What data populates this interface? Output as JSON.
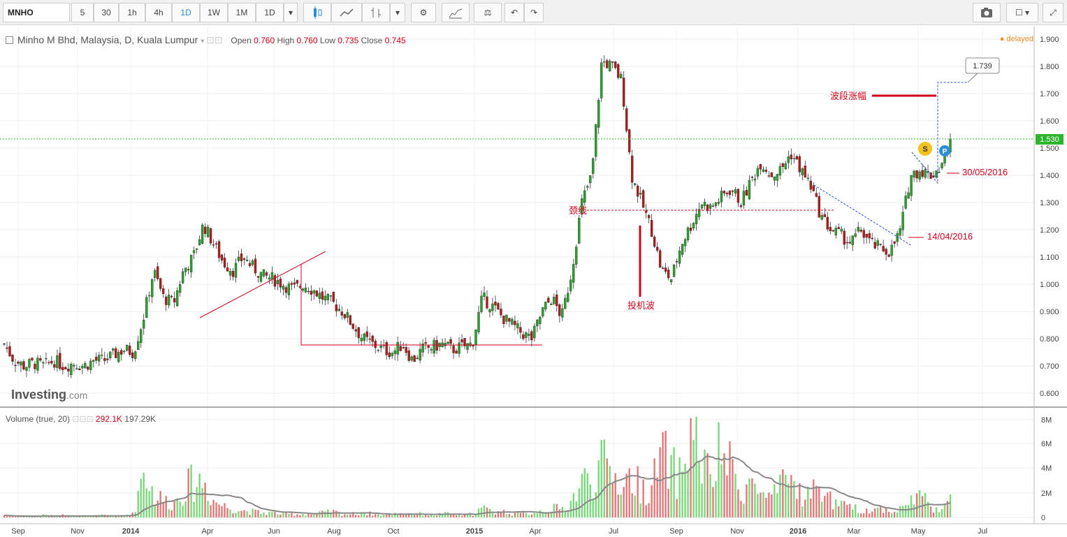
{
  "toolbar": {
    "symbol": "MNHO",
    "intervals": [
      "5",
      "30",
      "1h",
      "4h",
      "1D",
      "1W",
      "1M",
      "1D"
    ],
    "active_interval": "1D"
  },
  "legend": {
    "title": "Minho M Bhd, Malaysia, D, Kuala Lumpur",
    "open_label": "Open",
    "open": "0.760",
    "high_label": "High",
    "high": "0.760",
    "low_label": "Low",
    "low": "0.735",
    "close_label": "Close",
    "close": "0.745"
  },
  "status": {
    "delayed": "delayed"
  },
  "volume_legend": {
    "label": "Volume (true, 20)",
    "value1": "292.1K",
    "value2": "197.29K"
  },
  "logo": {
    "brand": "Investing",
    "suffix": ".com"
  },
  "annotations": {
    "neckline": "颈线",
    "speculative_wave": "投机波",
    "wave_rise": "波段涨幅",
    "target": "1.739",
    "date1": "30/05/2016",
    "date2": "14/04/2016",
    "marker_s": "S",
    "marker_p": "P"
  },
  "chart_data": {
    "type": "candlestick",
    "price_axis": [
      "1.900",
      "1.800",
      "1.700",
      "1.600",
      "1.500",
      "1.400",
      "1.300",
      "1.200",
      "1.100",
      "1.000",
      "0.900",
      "0.800",
      "0.700",
      "0.600"
    ],
    "volume_axis": [
      "8M",
      "6M",
      "4M",
      "2M",
      "0"
    ],
    "x_labels": [
      "Sep",
      "Nov",
      "2014",
      "Apr",
      "Jun",
      "Aug",
      "Oct",
      "2015",
      "Apr",
      "Jul",
      "Sep",
      "Nov",
      "2016",
      "Mar",
      "May",
      "Jul"
    ],
    "current_price": "1.530",
    "price_range": [
      0.55,
      1.93
    ],
    "price_path": [
      0.78,
      0.72,
      0.7,
      0.71,
      0.7,
      0.72,
      0.7,
      0.71,
      0.7,
      0.72,
      0.72,
      0.74,
      0.76,
      0.75,
      0.88,
      1.05,
      0.95,
      0.93,
      1.05,
      1.1,
      1.22,
      1.15,
      1.08,
      1.05,
      1.1,
      1.06,
      1.03,
      1.02,
      1.0,
      0.98,
      1.0,
      0.98,
      0.95,
      0.93,
      0.9,
      0.85,
      0.8,
      0.78,
      0.76,
      0.75,
      0.78,
      0.72,
      0.76,
      0.77,
      0.78,
      0.76,
      0.77,
      0.78,
      0.95,
      0.92,
      0.88,
      0.85,
      0.82,
      0.8,
      0.9,
      0.95,
      0.88,
      1.05,
      1.3,
      1.4,
      1.82,
      1.8,
      1.75,
      1.4,
      1.3,
      1.2,
      1.05,
      1.02,
      1.15,
      1.22,
      1.3,
      1.28,
      1.32,
      1.35,
      1.3,
      1.38,
      1.45,
      1.4,
      1.42,
      1.48,
      1.42,
      1.36,
      1.25,
      1.2,
      1.18,
      1.15,
      1.2,
      1.15,
      1.13,
      1.12,
      1.2,
      1.4,
      1.42,
      1.4,
      1.43,
      1.52
    ],
    "volume_path": [
      0.2,
      0.1,
      0.1,
      0.1,
      0.2,
      0.1,
      0.2,
      0.1,
      0.1,
      0.1,
      0.2,
      0.1,
      0.2,
      0.3,
      4.5,
      2.0,
      1.5,
      1.2,
      2.5,
      3.0,
      3.2,
      1.5,
      1.0,
      0.8,
      0.6,
      0.5,
      0.4,
      0.4,
      0.3,
      0.3,
      0.3,
      0.3,
      0.4,
      0.5,
      0.3,
      0.3,
      0.4,
      0.3,
      0.2,
      0.3,
      0.4,
      0.3,
      0.3,
      0.2,
      0.3,
      0.3,
      0.2,
      0.3,
      0.8,
      0.5,
      0.5,
      0.4,
      0.3,
      0.4,
      0.6,
      0.8,
      0.7,
      1.5,
      3.0,
      3.5,
      4.5,
      3.8,
      3.0,
      3.5,
      2.5,
      2.5,
      5.5,
      4.0,
      3.5,
      7.8,
      5.0,
      3.0,
      6.0,
      4.0,
      2.5,
      3.0,
      2.0,
      1.5,
      2.5,
      3.5,
      2.0,
      2.0,
      2.8,
      1.5,
      1.0,
      0.8,
      0.7,
      0.6,
      0.8,
      0.6,
      0.7,
      1.5,
      2.0,
      1.0,
      0.8,
      1.5
    ]
  }
}
